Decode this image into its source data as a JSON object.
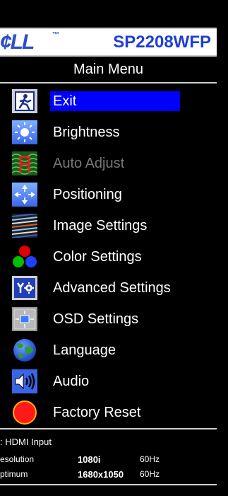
{
  "header": {
    "brand": "¢LL",
    "brand_tm": "™",
    "model": "SP2208WFP"
  },
  "main_menu": {
    "title": "Main Menu",
    "items": [
      {
        "label": "Exit",
        "icon": "exit-icon",
        "selected": true
      },
      {
        "label": "Brightness",
        "icon": "brightness-icon"
      },
      {
        "label": "Auto Adjust",
        "icon": "auto-adjust-icon",
        "disabled": true
      },
      {
        "label": "Positioning",
        "icon": "positioning-icon"
      },
      {
        "label": "Image Settings",
        "icon": "image-settings-icon"
      },
      {
        "label": "Color Settings",
        "icon": "color-settings-icon"
      },
      {
        "label": "Advanced Settings",
        "icon": "advanced-settings-icon"
      },
      {
        "label": "OSD Settings",
        "icon": "osd-settings-icon"
      },
      {
        "label": "Language",
        "icon": "language-icon"
      },
      {
        "label": "Audio",
        "icon": "audio-icon"
      },
      {
        "label": "Factory Reset",
        "icon": "factory-reset-icon"
      }
    ]
  },
  "status": {
    "input": ": HDMI Input",
    "resolution_label": "esolution",
    "resolution_value": "1080i",
    "resolution_hz": "60Hz",
    "optimum_label": "ptimum",
    "optimum_value": "1680x1050",
    "optimum_hz": "60Hz"
  },
  "colors": {
    "selected_bg": "#0000ff",
    "brand_blue": "#2d4fc7",
    "disabled_text": "#777777"
  }
}
